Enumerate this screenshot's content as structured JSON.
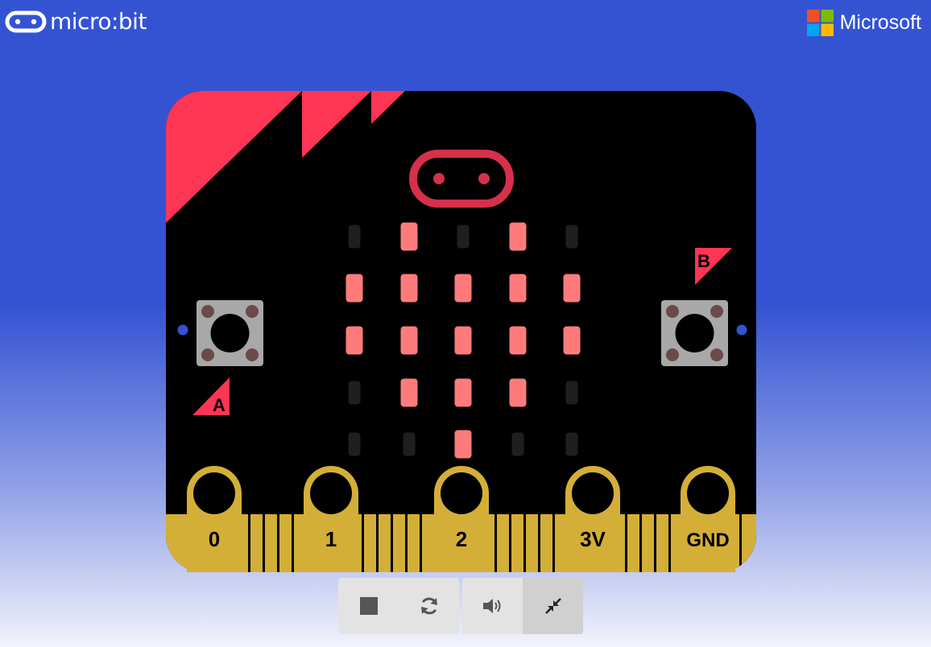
{
  "header": {
    "brand_name": "micro:bit",
    "partner_name": "Microsoft",
    "brand_icon": "microbit-logo-icon",
    "partner_icon": "microsoft-logo-icon"
  },
  "board": {
    "button_a_label": "A",
    "button_b_label": "B",
    "pins": [
      {
        "label": "0"
      },
      {
        "label": "1"
      },
      {
        "label": "2"
      },
      {
        "label": "3V"
      },
      {
        "label": "GND"
      }
    ],
    "led_matrix": [
      [
        0,
        1,
        0,
        1,
        0
      ],
      [
        1,
        1,
        1,
        1,
        1
      ],
      [
        1,
        1,
        1,
        1,
        1
      ],
      [
        0,
        1,
        1,
        1,
        0
      ],
      [
        0,
        0,
        1,
        0,
        0
      ]
    ]
  },
  "controls": [
    {
      "name": "stop-button",
      "icon": "stop-icon"
    },
    {
      "name": "restart-button",
      "icon": "restart-icon"
    },
    {
      "name": "sound-button",
      "icon": "speaker-icon"
    },
    {
      "name": "exit-fullscreen-button",
      "icon": "collapse-icon"
    }
  ],
  "colors": {
    "background": "#3453d3",
    "board": "#000000",
    "accent": "#ff3554",
    "led_on": "#ff7b7b",
    "led_off": "#1f1f1f",
    "pins": "#d4af37",
    "logo_ring": "#d6304a"
  }
}
